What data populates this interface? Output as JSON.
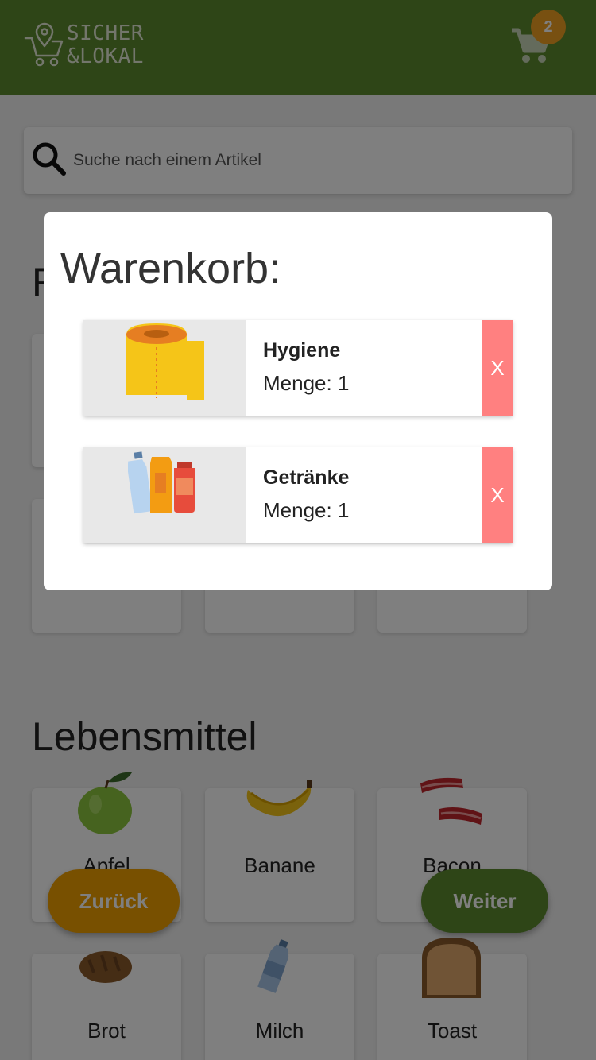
{
  "header": {
    "logo_line1": "SICHER",
    "logo_line2": "&LOKAL",
    "cart_count": "2",
    "accent_color": "#5c8a2e",
    "badge_color": "#f0a022",
    "logo_icon": "cart-pin-icon",
    "cart_icon": "shopping-cart-icon"
  },
  "search": {
    "placeholder": "Suche nach einem Artikel",
    "icon": "search-icon"
  },
  "sections": {
    "hidden_title_initial": "F",
    "lebensmittel": {
      "title": "Lebensmittel",
      "items": [
        {
          "label": "Apfel",
          "icon": "apple-icon"
        },
        {
          "label": "Banane",
          "icon": "banana-icon"
        },
        {
          "label": "Bacon",
          "icon": "bacon-icon"
        },
        {
          "label": "Brot",
          "icon": "bread-icon"
        },
        {
          "label": "Milch",
          "icon": "milk-bottle-icon"
        },
        {
          "label": "Toast",
          "icon": "toast-icon"
        }
      ]
    }
  },
  "buttons": {
    "back": "Zurück",
    "next": "Weiter"
  },
  "modal": {
    "title": "Warenkorb:",
    "items": [
      {
        "name": "Hygiene",
        "qty": "Menge: 1",
        "remove": "X",
        "icon": "toilet-paper-icon"
      },
      {
        "name": "Getränke",
        "qty": "Menge: 1",
        "remove": "X",
        "icon": "drinks-icon"
      }
    ],
    "remove_color": "#ff8080"
  }
}
